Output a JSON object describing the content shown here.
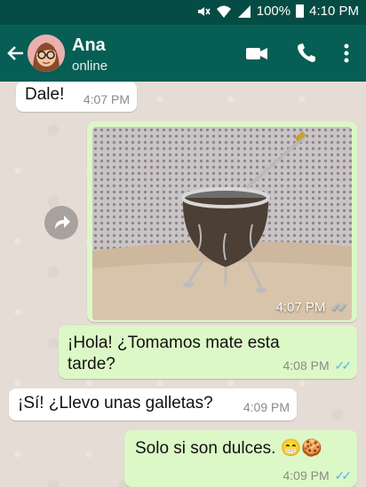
{
  "status_bar": {
    "battery": "100%",
    "time": "4:10 PM"
  },
  "header": {
    "contact_name": "Ana",
    "contact_status": "online"
  },
  "messages": [
    {
      "direction": "incoming",
      "text": "Dale!",
      "time": "4:07 PM"
    },
    {
      "direction": "outgoing",
      "type": "image",
      "image_subject": "mate",
      "time": "4:07 PM",
      "read": true
    },
    {
      "direction": "outgoing",
      "text": "¡Hola! ¿Tomamos mate esta tarde?",
      "time": "4:08 PM",
      "read": true
    },
    {
      "direction": "incoming",
      "text": "¡Sí! ¿Llevo unas galletas?",
      "time": "4:09 PM"
    },
    {
      "direction": "outgoing",
      "text": "Solo si son dulces. 😁🍪",
      "time": "4:09 PM",
      "read": true
    }
  ],
  "colors": {
    "header": "#075e54",
    "status_bar": "#054d44",
    "outgoing_bubble": "#dcf8c6",
    "incoming_bubble": "#ffffff",
    "read_ticks": "#4fb6ec",
    "chat_bg": "#e5ddd5"
  }
}
